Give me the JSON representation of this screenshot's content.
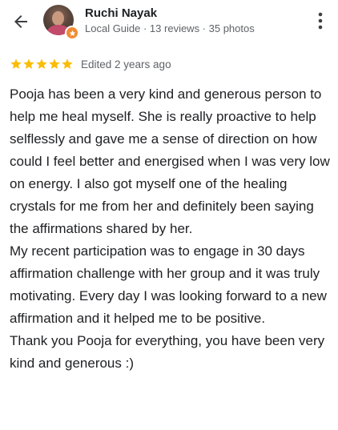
{
  "reviewer": {
    "name": "Ruchi Nayak",
    "meta": "Local Guide · 13 reviews · 35 photos"
  },
  "rating": {
    "stars": 5,
    "edited": "Edited 2 years ago"
  },
  "review": {
    "paragraphs": [
      "Pooja has been a very kind and generous person to help me heal myself. She is really proactive to help selflessly and gave me a sense of direction on how could I feel better and energised when I was very low on energy. I also got myself one of the healing crystals for me from her and definitely been saying the affirmations shared by her.",
      "My recent participation was to engage in 30 days affirmation challenge with her group and it was truly motivating. Every day I was looking forward to a new affirmation and it helped me to be positive.",
      "Thank you Pooja for everything, you have been very kind and generous :)"
    ]
  },
  "icons": {
    "back": "arrow-left-icon",
    "more": "more-vert-icon",
    "star": "star-icon",
    "badge": "local-guide-badge-icon"
  },
  "colors": {
    "star": "#fbbc04",
    "badge": "#f28b30",
    "secondary_text": "#5f6368",
    "primary_text": "#202124"
  }
}
